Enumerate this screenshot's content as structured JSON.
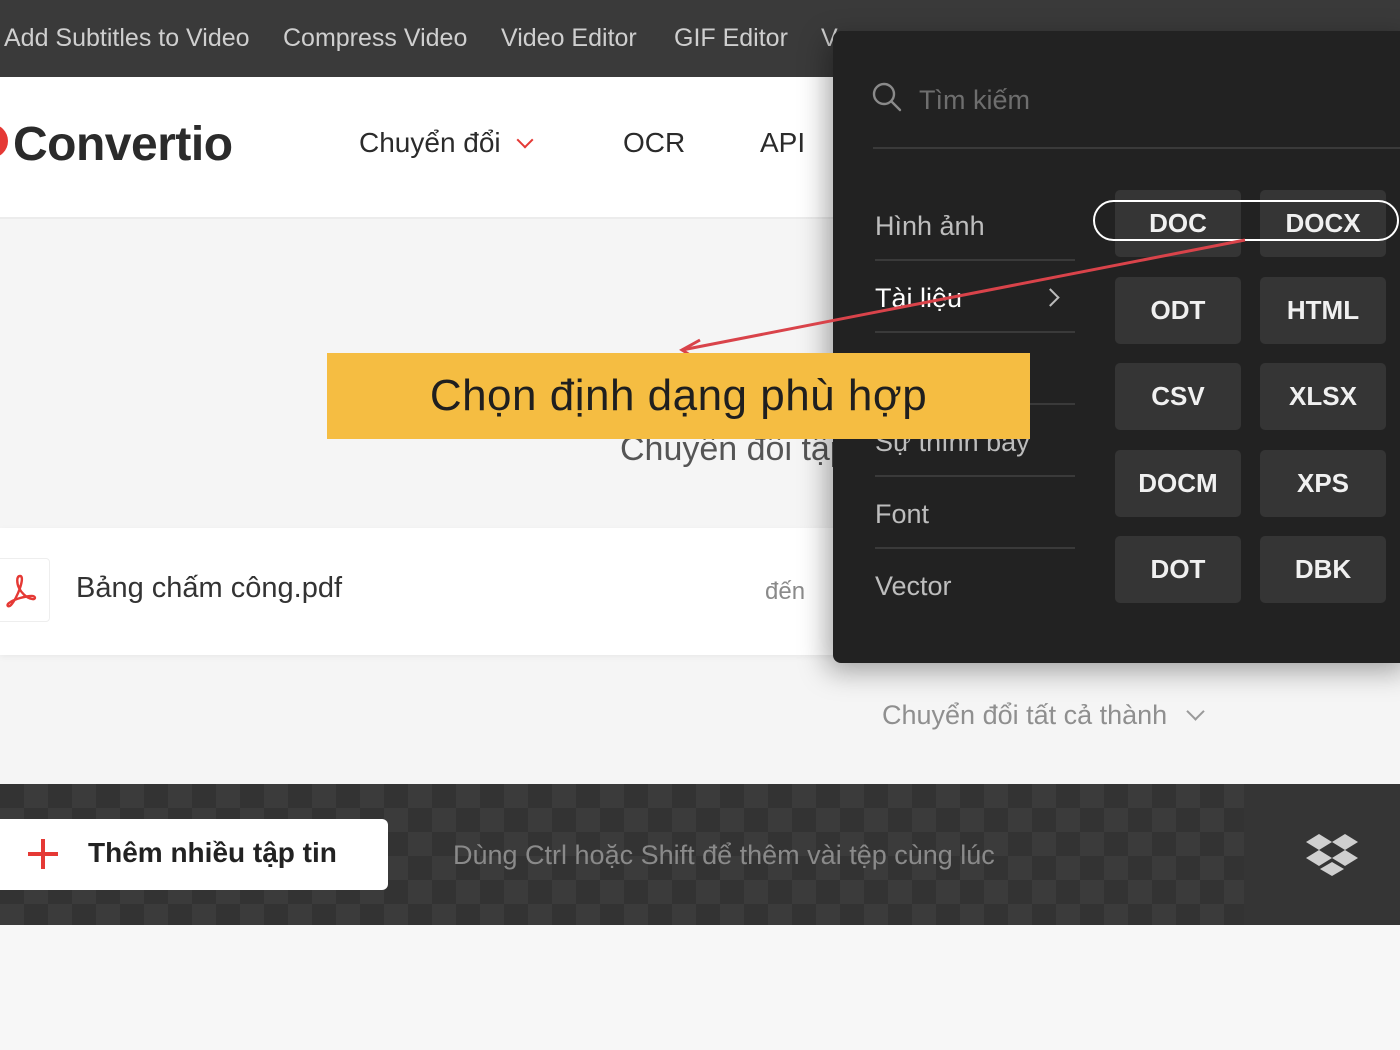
{
  "topbar": {
    "links": [
      "Add Subtitles to Video",
      "Compress Video",
      "Video Editor",
      "GIF Editor",
      "V"
    ]
  },
  "header": {
    "logo": "Convertio",
    "nav": [
      "Chuyển đổi",
      "OCR",
      "API"
    ]
  },
  "hero": {
    "subtitle": "Chuyển đổi tập"
  },
  "file": {
    "name": "Bảng chấm công.pdf",
    "to_label": "đến"
  },
  "convert_all": {
    "label": "Chuyển đổi tất cả thành"
  },
  "bottom": {
    "add_button": "Thêm nhiều tập tin",
    "hint": "Dùng Ctrl hoặc Shift để thêm vài tệp cùng lúc"
  },
  "dropdown": {
    "search_placeholder": "Tìm kiếm",
    "categories": [
      "Hình ảnh",
      "Tài liệu",
      "",
      "Sự thình bày",
      "Font",
      "Vector"
    ],
    "formats": [
      "DOC",
      "DOCX",
      "ODT",
      "HTML",
      "CSV",
      "XLSX",
      "DOCM",
      "XPS",
      "DOT",
      "DBK"
    ]
  },
  "callout": {
    "text": "Chọn định dạng phù hợp"
  },
  "colors": {
    "accent": "#e53935",
    "callout": "#f5bd42",
    "dropdown_bg": "#222222",
    "format_button": "#353535"
  }
}
